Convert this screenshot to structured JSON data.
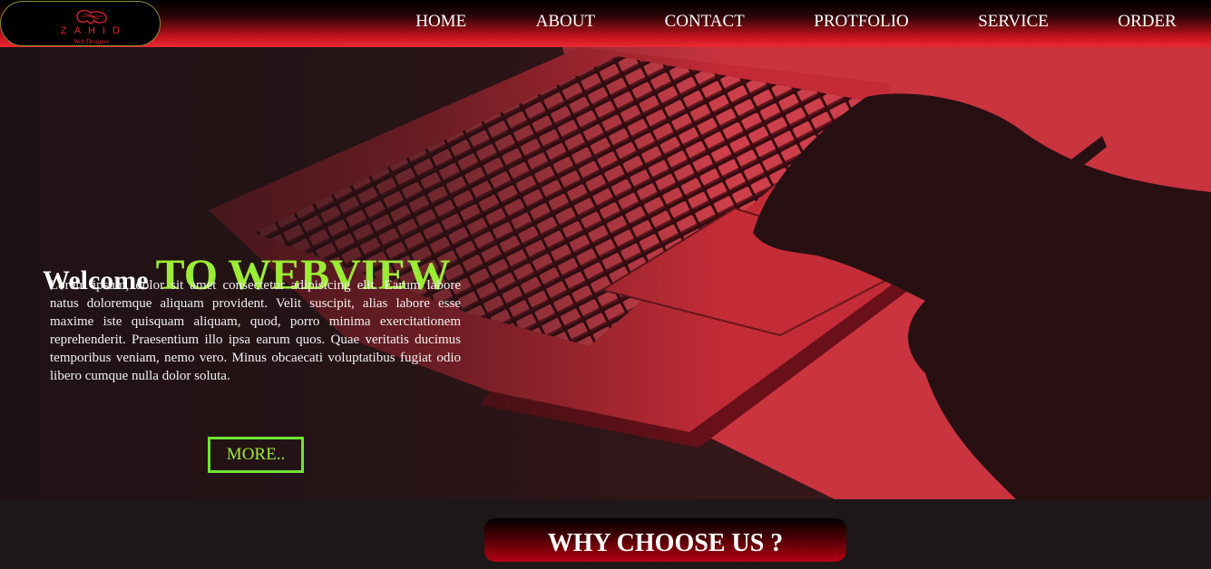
{
  "logo": {
    "name": "ZAHID",
    "tagline": "Web Designer"
  },
  "nav": {
    "items": [
      {
        "label": "HOME"
      },
      {
        "label": "ABOUT"
      },
      {
        "label": "CONTACT"
      },
      {
        "label": "PROTFOLIO"
      },
      {
        "label": "SERVICE"
      },
      {
        "label": "ORDER"
      }
    ]
  },
  "hero": {
    "welcome": "Welcome",
    "brand": "TO WEBVIEW",
    "text": "Lorem ipsum, dolor sit amet consectetur adipisicing elit. Earum labore natus doloremque aliquam provident. Velit suscipit, alias labore esse maxime iste quisquam aliquam, quod, porro minima exercitationem reprehenderit. Praesentium illo ipsa earum quos. Quae veritatis ducimus temporibus veniam, nemo vero. Minus obcaecati voluptatibus fugiat odio libero cumque nulla dolor soluta.",
    "button": "MORE.."
  },
  "section": {
    "why_title": "WHY CHOOSE US ?"
  },
  "colors": {
    "accent_green": "#9bec35",
    "accent_red": "#f23a48",
    "dark": "#1e1719"
  }
}
